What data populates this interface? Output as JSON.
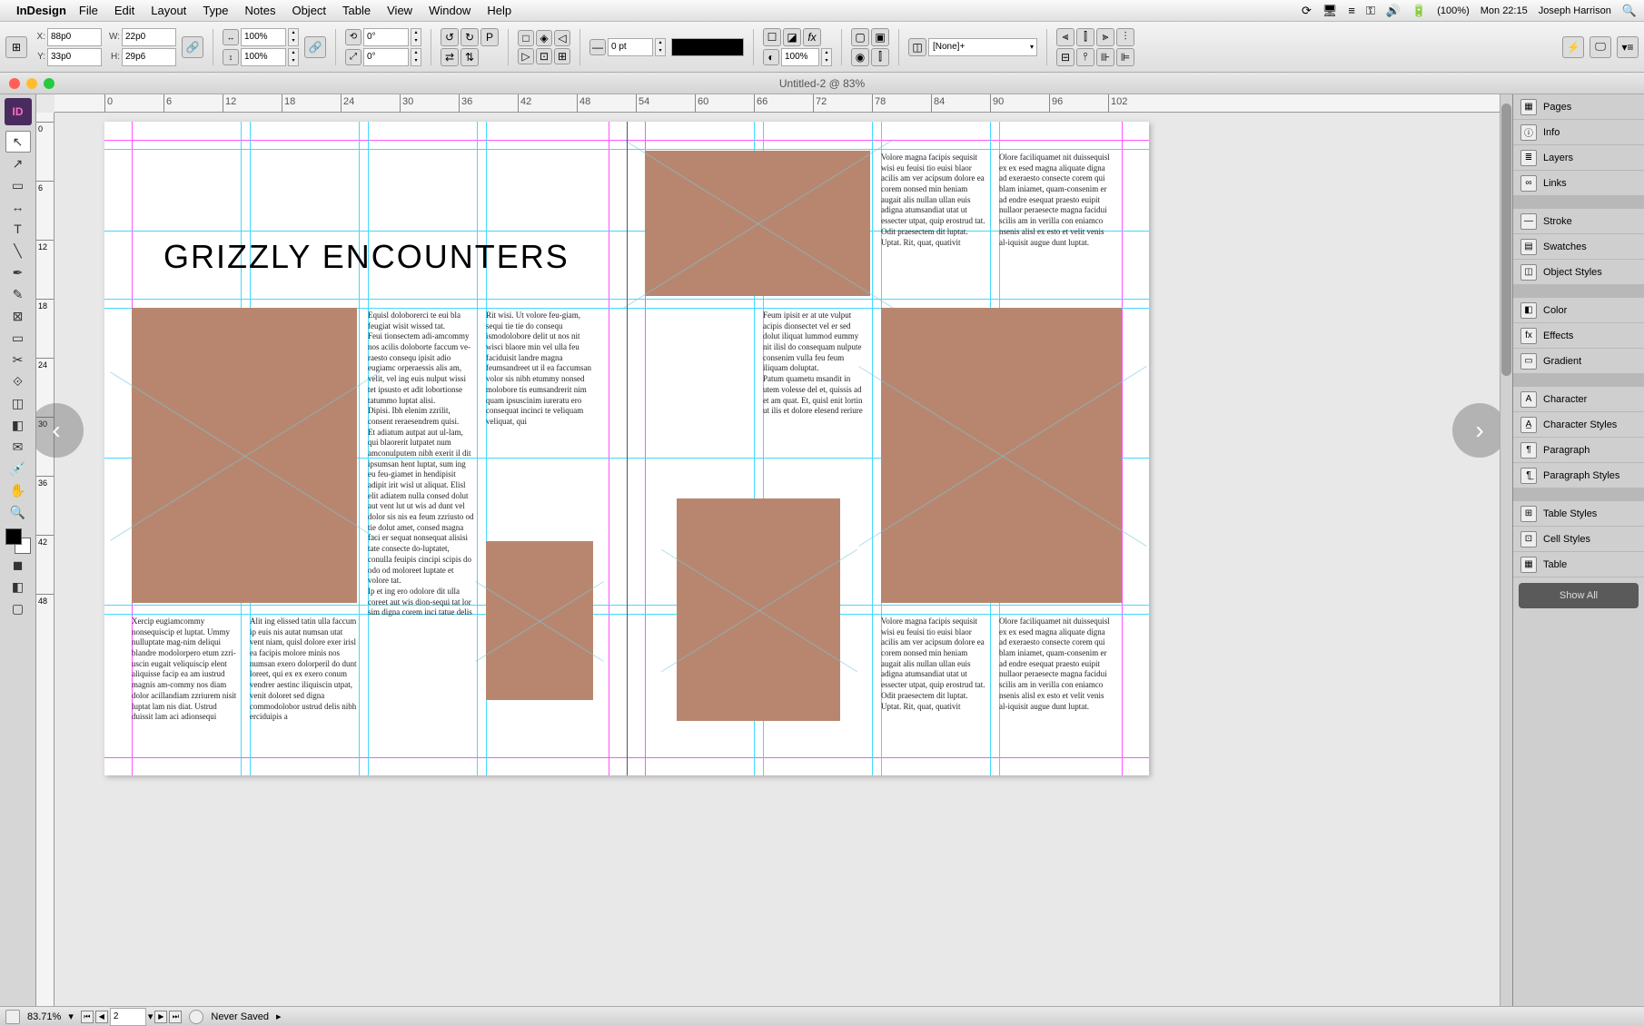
{
  "menubar": {
    "app": "InDesign",
    "items": [
      "File",
      "Edit",
      "Layout",
      "Type",
      "Notes",
      "Object",
      "Table",
      "View",
      "Window",
      "Help"
    ],
    "battery": "(100%)",
    "clock": "Mon 22:15",
    "user": "Joseph Harrison"
  },
  "control": {
    "x": "88p0",
    "y": "33p0",
    "w": "22p0",
    "h": "29p6",
    "scaleX": "100%",
    "scaleY": "100%",
    "rot": "0°",
    "shear": "0°",
    "strokeWeight": "0 pt",
    "opacity": "100%",
    "styleSel": "[None]+"
  },
  "win": {
    "title": "Untitled-2 @ 83%"
  },
  "hruler": [
    "0",
    "6",
    "12",
    "18",
    "24",
    "30",
    "36",
    "42",
    "48",
    "54",
    "60",
    "66",
    "72",
    "78",
    "84",
    "90",
    "96",
    "102"
  ],
  "vruler": [
    "0",
    "6",
    "12",
    "18",
    "24",
    "30",
    "36",
    "42",
    "48"
  ],
  "headline": "GRIZZLY ENCOUNTERS",
  "text": {
    "col1": "Volore magna facipis sequisit wisi eu feuisi tio euisi blaor acilis am ver acipsum dolore ea corem nonsed min heniam augait alis nullan ullan euis adigna atumsandiat utat ut essecter utpat, quip erostrud tat.\nOdit praesectem dit luptat.\nUptat. Rit, quat, quativit",
    "col2": "Olore faciliquamet nit duissequisl ex ex esed magna aliquate digna ad exeraesto consecte corem qui blam iniamet, quam-consenim er ad endre esequat praesto euipit nullaor peraesecte magna facidui scilis am in verilla con eniamco nsenis alisl ex esto et velit venis al-iquisit augue dunt luptat.",
    "body1": "Equisl doloborerci te eui bla feugiat wisit wissed tat.\nFeui tionsectem adi-amcommy nos acilis doloborte faccum ve-raesto consequ ipisit adio eugiamc orperaessis alis am, velit, vel ing euis nulput wissi tet ipsusto et adit lobortionse tatummo luptat alisi.\nDipisi. Ibh elenim zzrilit, consent reraesendrem quisi.\nEt adiatum autpat aut ul-lam, qui blaorerit lutpatet num amconulputem nibh exerit il dit ipsumsan hent luptat, sum ing eu feu-giamet in hendipisit adipit irit wisl ut aliquat. Elisl elit adiatem nulla consed dolut aut vent lut ut wis ad dunt vel dolor sis nis ea feum zzriusto od tie dolut amet, consed magna faci er sequat nonsequat alisisi tate consecte do-luptatet, conulla feuipis cincipi scipis do odo od moloreet luptate et volore tat.\nIp et ing ero odolore dit ulla coreet aut wis dion-sequi tat lor sim digna corem inci tatue delis",
    "body2": "Rit wisi. Ut volore feu-giam, sequi tie tie do consequ ismodolobore delit ut nos nit wisci blaore min vel ulla feu faciduisit landre magna feumsandreet ut il ea faccumsan volor sis nibh etummy nonsed molobore tis eumsandrerit nim quam ipsuscinim iureratu ero consequat incinci te veliquam veliquat, qui",
    "body3": "Feum ipisit er at ute vulput acipis dionsectet vel er sed dolut iliquat lummod eummy nit ilisl do consequam nulpute consenim vulla feu feum iliquam doluptat.\nPatum quametu msandit in utem volesse del et, quissis ad et am quat. Et, quisl enit lortin ut ilis et dolore elesend reriure",
    "foot1": "Xercip eugiamcommy nonsequiscip et luptat. Ummy nulluptate mag-nim deliqui blandre modolorpero etum zzri-uscin eugait veliquiscip elent aliquisse facip ea am iustrud magnis am-commy nos diam dolor acillandiam zzriurem nisit luptat lam nis diat. Ustrud duissit lam aci adionsequi",
    "foot2": "Alit ing elissed tatin ulla faccum ip euis nis autat numsan utat vent niam, quisl dolore exer irisl ea facipis molore minis nos numsan exero dolorperil do dunt loreet, qui ex ex exero conum vendrer aestinc iliquiscin utpat, venit doloret sed digna commodolobor ustrud delis nibh erciduipis a"
  },
  "panels": [
    {
      "icon": "▦",
      "label": "Pages"
    },
    {
      "icon": "ⓘ",
      "label": "Info"
    },
    {
      "icon": "≣",
      "label": "Layers"
    },
    {
      "icon": "∞",
      "label": "Links"
    },
    {
      "gap": true
    },
    {
      "icon": "—",
      "label": "Stroke"
    },
    {
      "icon": "▤",
      "label": "Swatches"
    },
    {
      "icon": "◫",
      "label": "Object Styles"
    },
    {
      "gap": true
    },
    {
      "icon": "◧",
      "label": "Color"
    },
    {
      "icon": "fx",
      "label": "Effects"
    },
    {
      "icon": "▭",
      "label": "Gradient"
    },
    {
      "gap": true
    },
    {
      "icon": "A",
      "label": "Character"
    },
    {
      "icon": "A̲",
      "label": "Character Styles"
    },
    {
      "icon": "¶",
      "label": "Paragraph"
    },
    {
      "icon": "¶̲",
      "label": "Paragraph Styles"
    },
    {
      "gap": true
    },
    {
      "icon": "⊞",
      "label": "Table Styles"
    },
    {
      "icon": "⊡",
      "label": "Cell Styles"
    },
    {
      "icon": "▦",
      "label": "Table"
    }
  ],
  "showall": "Show All",
  "status": {
    "zoom": "83.71%",
    "page": "2",
    "saved": "Never Saved"
  },
  "tools": [
    "sel",
    "direct",
    "page",
    "gap",
    "type",
    "line",
    "pen",
    "pencil",
    "rectframe",
    "rect",
    "scissors",
    "free",
    "rotate",
    "grad",
    "note",
    "eyedrop",
    "hand",
    "zoom"
  ]
}
